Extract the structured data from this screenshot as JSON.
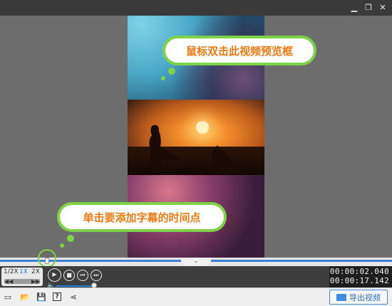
{
  "window": {
    "minimize_icon": "minimize-icon",
    "restore_icon": "restore-icon",
    "close_icon": "close-icon",
    "minimize_glyph": "▁",
    "restore_glyph": "❐",
    "close_glyph": "✕"
  },
  "tooltips": {
    "preview_hint": "鼠标双击此视频预览框",
    "subtitle_hint": "单击要添加字幕的时间点"
  },
  "colors": {
    "bubble_green": "#7ed247",
    "bubble_text": "#f07a12",
    "accent_blue": "#3f8be0"
  },
  "timeline": {
    "collapse_glyph": "⌄",
    "progress": 0.12
  },
  "speed": {
    "options": [
      "1/2X",
      "1X",
      "2X"
    ],
    "selected": "1X",
    "rewind_glyph": "◀◀",
    "forward_glyph": "▶▶"
  },
  "playback": {
    "play_glyph": "▶",
    "stop_glyph": "■",
    "prev_glyph": "⏮",
    "next_glyph": "⏭",
    "volume_glyph": "🔈"
  },
  "time": {
    "current": "00:00:02.040",
    "total": "00:00:17.142"
  },
  "toolbar": {
    "icons": [
      "subtitle-icon",
      "folder-icon",
      "save-icon",
      "help-icon",
      "share-icon"
    ],
    "glyphs": [
      "▭",
      "📂",
      "💾",
      "?",
      "⋖"
    ],
    "export_label": "导出视频"
  }
}
